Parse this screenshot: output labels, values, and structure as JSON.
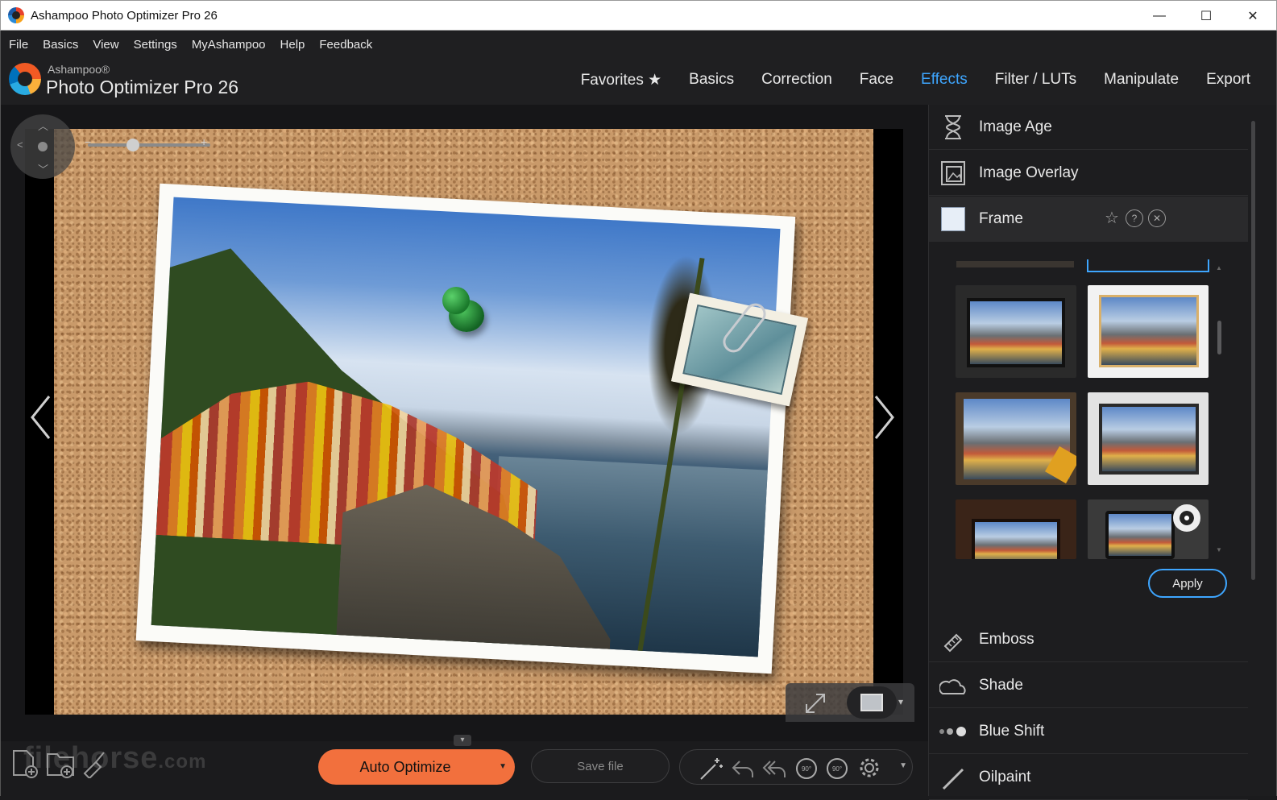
{
  "window": {
    "title": "Ashampoo Photo Optimizer Pro 26",
    "controls": [
      "—",
      "☐",
      "✕"
    ]
  },
  "menu": [
    "File",
    "Basics",
    "View",
    "Settings",
    "MyAshampoo",
    "Help",
    "Feedback"
  ],
  "brand": {
    "small": "Ashampoo®",
    "big": "Photo Optimizer Pro 26"
  },
  "nav": {
    "items": [
      "Favorites ★",
      "Basics",
      "Correction",
      "Face",
      "Effects",
      "Filter / LUTs",
      "Manipulate",
      "Export"
    ],
    "active": "Effects"
  },
  "bottom": {
    "watermark": "filehorse",
    "watermark_suffix": ".com",
    "auto_optimize": "Auto Optimize",
    "save_file": "Save file"
  },
  "panel": {
    "rows_top": [
      {
        "label": "Image Age",
        "icon": "hourglass-icon"
      },
      {
        "label": "Image Overlay",
        "icon": "image-overlay-icon"
      },
      {
        "label": "Frame",
        "icon": "frame-icon"
      }
    ],
    "rows_bottom": [
      {
        "label": "Emboss",
        "icon": "emboss-icon"
      },
      {
        "label": "Shade",
        "icon": "shade-icon"
      },
      {
        "label": "Blue Shift",
        "icon": "blue-shift-icon"
      },
      {
        "label": "Oilpaint",
        "icon": "oilpaint-icon"
      }
    ],
    "apply": "Apply"
  },
  "colors": {
    "accent": "#3ea6ff",
    "auto_optimize": "#f2703d",
    "background": "#1b1b1d"
  }
}
